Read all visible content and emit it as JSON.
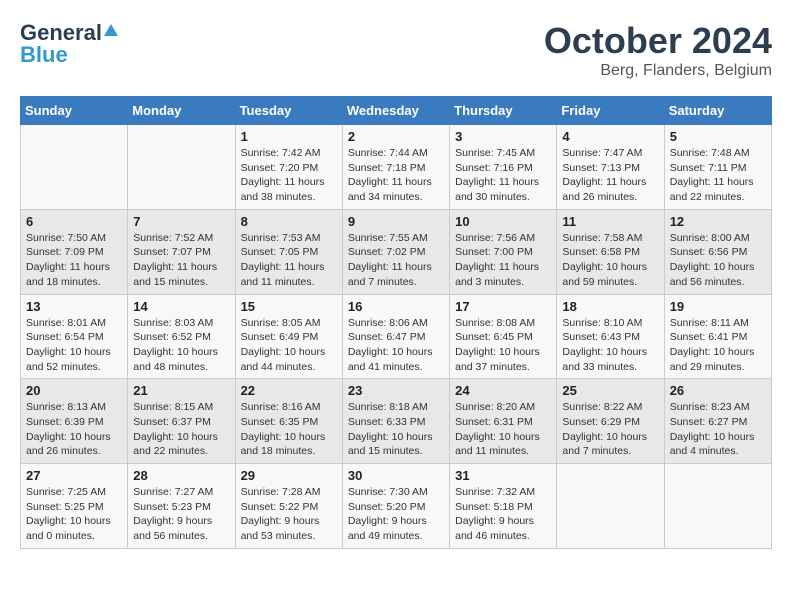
{
  "header": {
    "logo_general": "General",
    "logo_blue": "Blue",
    "month_title": "October 2024",
    "location": "Berg, Flanders, Belgium"
  },
  "weekdays": [
    "Sunday",
    "Monday",
    "Tuesday",
    "Wednesday",
    "Thursday",
    "Friday",
    "Saturday"
  ],
  "weeks": [
    [
      {
        "day": "",
        "sunrise": "",
        "sunset": "",
        "daylight": ""
      },
      {
        "day": "",
        "sunrise": "",
        "sunset": "",
        "daylight": ""
      },
      {
        "day": "1",
        "sunrise": "Sunrise: 7:42 AM",
        "sunset": "Sunset: 7:20 PM",
        "daylight": "Daylight: 11 hours and 38 minutes."
      },
      {
        "day": "2",
        "sunrise": "Sunrise: 7:44 AM",
        "sunset": "Sunset: 7:18 PM",
        "daylight": "Daylight: 11 hours and 34 minutes."
      },
      {
        "day": "3",
        "sunrise": "Sunrise: 7:45 AM",
        "sunset": "Sunset: 7:16 PM",
        "daylight": "Daylight: 11 hours and 30 minutes."
      },
      {
        "day": "4",
        "sunrise": "Sunrise: 7:47 AM",
        "sunset": "Sunset: 7:13 PM",
        "daylight": "Daylight: 11 hours and 26 minutes."
      },
      {
        "day": "5",
        "sunrise": "Sunrise: 7:48 AM",
        "sunset": "Sunset: 7:11 PM",
        "daylight": "Daylight: 11 hours and 22 minutes."
      }
    ],
    [
      {
        "day": "6",
        "sunrise": "Sunrise: 7:50 AM",
        "sunset": "Sunset: 7:09 PM",
        "daylight": "Daylight: 11 hours and 18 minutes."
      },
      {
        "day": "7",
        "sunrise": "Sunrise: 7:52 AM",
        "sunset": "Sunset: 7:07 PM",
        "daylight": "Daylight: 11 hours and 15 minutes."
      },
      {
        "day": "8",
        "sunrise": "Sunrise: 7:53 AM",
        "sunset": "Sunset: 7:05 PM",
        "daylight": "Daylight: 11 hours and 11 minutes."
      },
      {
        "day": "9",
        "sunrise": "Sunrise: 7:55 AM",
        "sunset": "Sunset: 7:02 PM",
        "daylight": "Daylight: 11 hours and 7 minutes."
      },
      {
        "day": "10",
        "sunrise": "Sunrise: 7:56 AM",
        "sunset": "Sunset: 7:00 PM",
        "daylight": "Daylight: 11 hours and 3 minutes."
      },
      {
        "day": "11",
        "sunrise": "Sunrise: 7:58 AM",
        "sunset": "Sunset: 6:58 PM",
        "daylight": "Daylight: 10 hours and 59 minutes."
      },
      {
        "day": "12",
        "sunrise": "Sunrise: 8:00 AM",
        "sunset": "Sunset: 6:56 PM",
        "daylight": "Daylight: 10 hours and 56 minutes."
      }
    ],
    [
      {
        "day": "13",
        "sunrise": "Sunrise: 8:01 AM",
        "sunset": "Sunset: 6:54 PM",
        "daylight": "Daylight: 10 hours and 52 minutes."
      },
      {
        "day": "14",
        "sunrise": "Sunrise: 8:03 AM",
        "sunset": "Sunset: 6:52 PM",
        "daylight": "Daylight: 10 hours and 48 minutes."
      },
      {
        "day": "15",
        "sunrise": "Sunrise: 8:05 AM",
        "sunset": "Sunset: 6:49 PM",
        "daylight": "Daylight: 10 hours and 44 minutes."
      },
      {
        "day": "16",
        "sunrise": "Sunrise: 8:06 AM",
        "sunset": "Sunset: 6:47 PM",
        "daylight": "Daylight: 10 hours and 41 minutes."
      },
      {
        "day": "17",
        "sunrise": "Sunrise: 8:08 AM",
        "sunset": "Sunset: 6:45 PM",
        "daylight": "Daylight: 10 hours and 37 minutes."
      },
      {
        "day": "18",
        "sunrise": "Sunrise: 8:10 AM",
        "sunset": "Sunset: 6:43 PM",
        "daylight": "Daylight: 10 hours and 33 minutes."
      },
      {
        "day": "19",
        "sunrise": "Sunrise: 8:11 AM",
        "sunset": "Sunset: 6:41 PM",
        "daylight": "Daylight: 10 hours and 29 minutes."
      }
    ],
    [
      {
        "day": "20",
        "sunrise": "Sunrise: 8:13 AM",
        "sunset": "Sunset: 6:39 PM",
        "daylight": "Daylight: 10 hours and 26 minutes."
      },
      {
        "day": "21",
        "sunrise": "Sunrise: 8:15 AM",
        "sunset": "Sunset: 6:37 PM",
        "daylight": "Daylight: 10 hours and 22 minutes."
      },
      {
        "day": "22",
        "sunrise": "Sunrise: 8:16 AM",
        "sunset": "Sunset: 6:35 PM",
        "daylight": "Daylight: 10 hours and 18 minutes."
      },
      {
        "day": "23",
        "sunrise": "Sunrise: 8:18 AM",
        "sunset": "Sunset: 6:33 PM",
        "daylight": "Daylight: 10 hours and 15 minutes."
      },
      {
        "day": "24",
        "sunrise": "Sunrise: 8:20 AM",
        "sunset": "Sunset: 6:31 PM",
        "daylight": "Daylight: 10 hours and 11 minutes."
      },
      {
        "day": "25",
        "sunrise": "Sunrise: 8:22 AM",
        "sunset": "Sunset: 6:29 PM",
        "daylight": "Daylight: 10 hours and 7 minutes."
      },
      {
        "day": "26",
        "sunrise": "Sunrise: 8:23 AM",
        "sunset": "Sunset: 6:27 PM",
        "daylight": "Daylight: 10 hours and 4 minutes."
      }
    ],
    [
      {
        "day": "27",
        "sunrise": "Sunrise: 7:25 AM",
        "sunset": "Sunset: 5:25 PM",
        "daylight": "Daylight: 10 hours and 0 minutes."
      },
      {
        "day": "28",
        "sunrise": "Sunrise: 7:27 AM",
        "sunset": "Sunset: 5:23 PM",
        "daylight": "Daylight: 9 hours and 56 minutes."
      },
      {
        "day": "29",
        "sunrise": "Sunrise: 7:28 AM",
        "sunset": "Sunset: 5:22 PM",
        "daylight": "Daylight: 9 hours and 53 minutes."
      },
      {
        "day": "30",
        "sunrise": "Sunrise: 7:30 AM",
        "sunset": "Sunset: 5:20 PM",
        "daylight": "Daylight: 9 hours and 49 minutes."
      },
      {
        "day": "31",
        "sunrise": "Sunrise: 7:32 AM",
        "sunset": "Sunset: 5:18 PM",
        "daylight": "Daylight: 9 hours and 46 minutes."
      },
      {
        "day": "",
        "sunrise": "",
        "sunset": "",
        "daylight": ""
      },
      {
        "day": "",
        "sunrise": "",
        "sunset": "",
        "daylight": ""
      }
    ]
  ]
}
